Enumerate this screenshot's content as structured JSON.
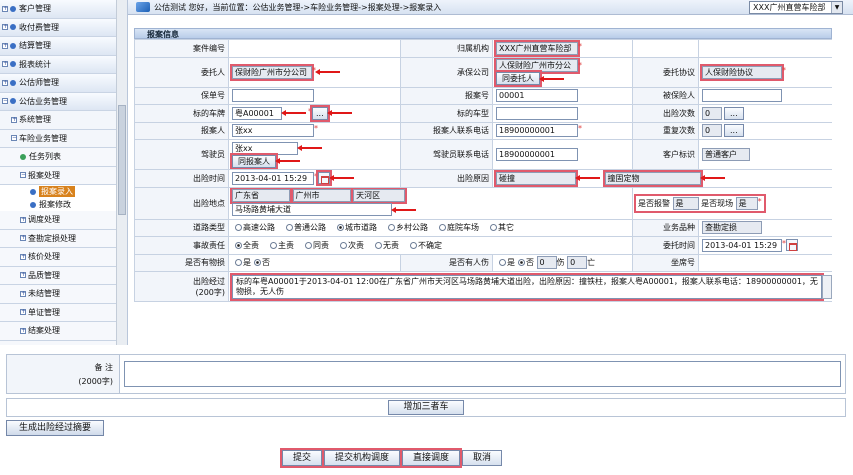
{
  "sidebar": {
    "items": [
      {
        "label": "客户管理",
        "level": 0,
        "marker": "plus"
      },
      {
        "label": "收付费管理",
        "level": 0,
        "marker": "plus"
      },
      {
        "label": "结算管理",
        "level": 0,
        "marker": "plus"
      },
      {
        "label": "报表统计",
        "level": 0,
        "marker": "plus"
      },
      {
        "label": "公估师管理",
        "level": 0,
        "marker": "plus"
      },
      {
        "label": "公估业务管理",
        "level": 0,
        "marker": "minus"
      },
      {
        "label": "系统管理",
        "level": 1,
        "marker": "plus"
      },
      {
        "label": "车险业务管理",
        "level": 1,
        "marker": "minus"
      },
      {
        "label": "任务列表",
        "level": 2,
        "marker": "dot"
      },
      {
        "label": "报案处理",
        "level": 2,
        "marker": "minus"
      },
      {
        "label": "报案录入",
        "level": 3,
        "marker": "dot",
        "selected": true
      },
      {
        "label": "报案修改",
        "level": 3,
        "marker": "dot"
      },
      {
        "label": "调度处理",
        "level": 2,
        "marker": "plus"
      },
      {
        "label": "查勘定损处理",
        "level": 2,
        "marker": "plus"
      },
      {
        "label": "核价处理",
        "level": 2,
        "marker": "plus"
      },
      {
        "label": "品质管理",
        "level": 2,
        "marker": "plus"
      },
      {
        "label": "未结管理",
        "level": 2,
        "marker": "plus"
      },
      {
        "label": "单证管理",
        "level": 2,
        "marker": "plus"
      },
      {
        "label": "结案处理",
        "level": 2,
        "marker": "plus"
      },
      {
        "label": "公估费处理",
        "level": 2,
        "marker": "plus"
      },
      {
        "label": "案件稽核",
        "level": 2,
        "marker": "plus"
      }
    ]
  },
  "header": {
    "crumb": "公估测试  您好，当前位置：公估业务管理->车险业务管理->报案处理->报案录入",
    "org_select": "XXX广州直营车险部"
  },
  "form": {
    "section_title": "报案信息",
    "labels": {
      "case_no": "案件编号",
      "org": "归属机构",
      "client": "委托人",
      "insurer": "承保公司",
      "agreement": "委托协议",
      "policy_no": "保单号",
      "report_no": "报案号",
      "insured": "被保险人",
      "plate": "标的车牌",
      "model": "标的车型",
      "times": "出险次数",
      "reporter": "报案人",
      "reporter_tel": "报案人联系电话",
      "repeat": "重复次数",
      "driver": "驾驶员",
      "driver_tel": "驾驶员联系电话",
      "client_tag": "客户标识",
      "accident_time": "出险时间",
      "cause": "出险原因",
      "location": "出险地点",
      "is_report_police": "是否报警",
      "is_on_scene": "是否现场",
      "road_type": "道路类型",
      "biz_type": "业务品种",
      "liability": "事故责任",
      "entrust_time": "委托时间",
      "property_loss": "是否有物损",
      "injury": "是否有人伤",
      "bank_no": "坐席号",
      "process": "出险经过",
      "process_limit": "(200字)"
    },
    "values": {
      "org": "XXX广州直营车险部",
      "client": "保财险广州市分公司",
      "insurer": "人保财险广州市分公",
      "agreement": "人保财险协议",
      "report_no": "00001",
      "plate": "粤A00001",
      "times": "0",
      "reporter": "张xx",
      "reporter_tel": "18900000001",
      "repeat": "0",
      "driver": "张xx",
      "driver_tel": "18900000001",
      "client_tag": "普通客户",
      "accident_time": "2013-04-01 15:29",
      "cause_1": "碰撞",
      "cause_2": "撞固定物",
      "province": "广东省",
      "city": "广州市",
      "district": "天河区",
      "street": "马场路黄埔大道",
      "police": "是",
      "scene": "是",
      "biz_type": "查勘定损",
      "entrust_time": "2013-04-01 15:29",
      "dead": "0",
      "hurt": "0",
      "process": "标的车粤A00001于2013-04-01 12:00在广东省广州市天河区马场路黄埔大道出险，出险原因：撞铁柱，报案人粤A00001，报案人联系电话：18900000001，无物损，无人伤"
    },
    "buttons": {
      "same_as_client": "同委托人",
      "same_as_reporter": "同报案人",
      "plate_lookup": "...",
      "times_btn": "...",
      "repeat_btn": "..."
    },
    "road_options": [
      "高速公路",
      "普通公路",
      "城市道路",
      "乡村公路",
      "庭院车场",
      "其它"
    ],
    "road_selected": 2,
    "liability_options": [
      "全责",
      "主责",
      "同责",
      "次责",
      "无责",
      "不确定"
    ],
    "liability_selected": 0,
    "yes": "是",
    "no": "否",
    "dead_unit": "伤",
    "hurt_unit": "亡"
  },
  "lower": {
    "remark_label": "备    注",
    "remark_limit": "(2000字)",
    "add_three_car": "增加三者车",
    "gen_summary": "生成出险经过摘要",
    "actions": [
      "提交",
      "提交机构调度",
      "直接调度",
      "取消"
    ]
  }
}
